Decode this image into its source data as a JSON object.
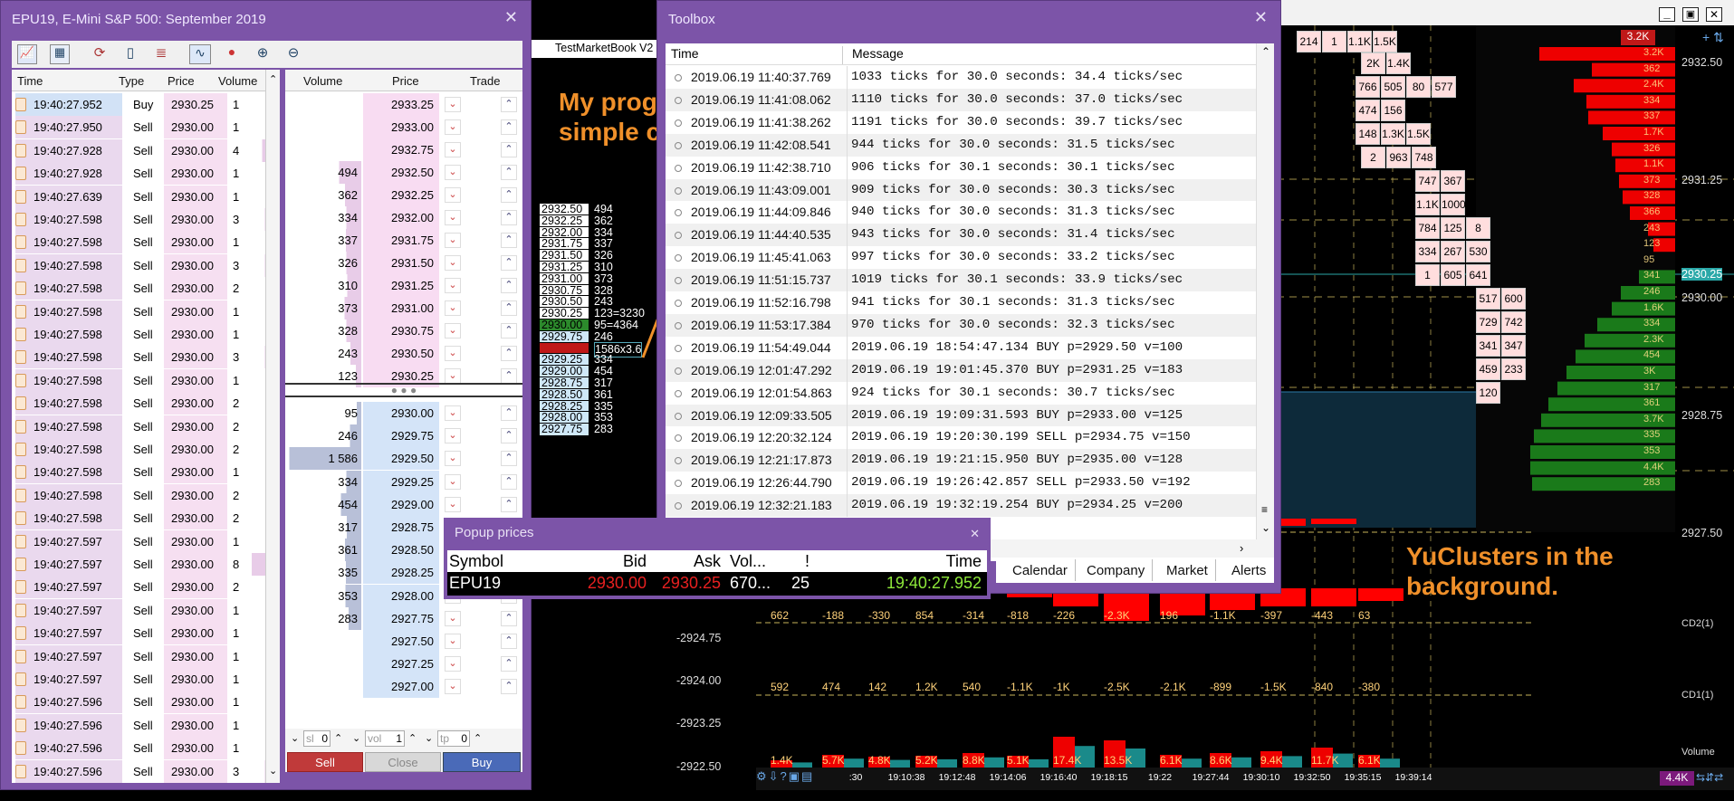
{
  "left_window": {
    "title": "EPU19, E-Mini S&P 500: September 2019",
    "ts_headers": [
      "Time",
      "Type",
      "Price",
      "Volume"
    ],
    "ts_rows": [
      [
        "19:40:27.952",
        "Buy",
        "2930.25",
        "1"
      ],
      [
        "19:40:27.950",
        "Sell",
        "2930.00",
        "1"
      ],
      [
        "19:40:27.928",
        "Sell",
        "2930.00",
        "4"
      ],
      [
        "19:40:27.928",
        "Sell",
        "2930.00",
        "1"
      ],
      [
        "19:40:27.639",
        "Sell",
        "2930.00",
        "1"
      ],
      [
        "19:40:27.598",
        "Sell",
        "2930.00",
        "3"
      ],
      [
        "19:40:27.598",
        "Sell",
        "2930.00",
        "1"
      ],
      [
        "19:40:27.598",
        "Sell",
        "2930.00",
        "3"
      ],
      [
        "19:40:27.598",
        "Sell",
        "2930.00",
        "2"
      ],
      [
        "19:40:27.598",
        "Sell",
        "2930.00",
        "1"
      ],
      [
        "19:40:27.598",
        "Sell",
        "2930.00",
        "1"
      ],
      [
        "19:40:27.598",
        "Sell",
        "2930.00",
        "3"
      ],
      [
        "19:40:27.598",
        "Sell",
        "2930.00",
        "1"
      ],
      [
        "19:40:27.598",
        "Sell",
        "2930.00",
        "2"
      ],
      [
        "19:40:27.598",
        "Sell",
        "2930.00",
        "2"
      ],
      [
        "19:40:27.598",
        "Sell",
        "2930.00",
        "2"
      ],
      [
        "19:40:27.598",
        "Sell",
        "2930.00",
        "1"
      ],
      [
        "19:40:27.598",
        "Sell",
        "2930.00",
        "2"
      ],
      [
        "19:40:27.598",
        "Sell",
        "2930.00",
        "2"
      ],
      [
        "19:40:27.597",
        "Sell",
        "2930.00",
        "1"
      ],
      [
        "19:40:27.597",
        "Sell",
        "2930.00",
        "8"
      ],
      [
        "19:40:27.597",
        "Sell",
        "2930.00",
        "2"
      ],
      [
        "19:40:27.597",
        "Sell",
        "2930.00",
        "1"
      ],
      [
        "19:40:27.597",
        "Sell",
        "2930.00",
        "1"
      ],
      [
        "19:40:27.597",
        "Sell",
        "2930.00",
        "1"
      ],
      [
        "19:40:27.597",
        "Sell",
        "2930.00",
        "1"
      ],
      [
        "19:40:27.596",
        "Sell",
        "2930.00",
        "1"
      ],
      [
        "19:40:27.596",
        "Sell",
        "2930.00",
        "1"
      ],
      [
        "19:40:27.596",
        "Sell",
        "2930.00",
        "1"
      ],
      [
        "19:40:27.596",
        "Sell",
        "2930.00",
        "3"
      ]
    ],
    "dom_headers": [
      "Volume",
      "Price",
      "Trade"
    ],
    "dom_asks": [
      [
        "",
        "2933.25"
      ],
      [
        "",
        "2933.00"
      ],
      [
        "",
        "2932.75"
      ],
      [
        "494",
        "2932.50"
      ],
      [
        "362",
        "2932.25"
      ],
      [
        "334",
        "2932.00"
      ],
      [
        "337",
        "2931.75"
      ],
      [
        "326",
        "2931.50"
      ],
      [
        "310",
        "2931.25"
      ],
      [
        "373",
        "2931.00"
      ],
      [
        "328",
        "2930.75"
      ],
      [
        "243",
        "2930.50"
      ],
      [
        "123",
        "2930.25"
      ]
    ],
    "dom_dots": "● ● ●",
    "dom_bids": [
      [
        "95",
        "2930.00"
      ],
      [
        "246",
        "2929.75"
      ],
      [
        "1 586",
        "2929.50"
      ],
      [
        "334",
        "2929.25"
      ],
      [
        "454",
        "2929.00"
      ],
      [
        "317",
        "2928.75"
      ],
      [
        "361",
        "2928.50"
      ],
      [
        "335",
        "2928.25"
      ],
      [
        "353",
        "2928.00"
      ],
      [
        "283",
        "2927.75"
      ],
      [
        "",
        "2927.50"
      ],
      [
        "",
        "2927.25"
      ],
      [
        "",
        "2927.00"
      ]
    ],
    "bottom": {
      "sl_label": "sl",
      "sl_val": "0",
      "vol_label": "vol",
      "vol_val": "1",
      "tp_label": "tp",
      "tp_val": "0",
      "sell": "Sell",
      "close": "Close",
      "buy": "Buy"
    }
  },
  "market_book": {
    "title": "TestMarketBook V2",
    "rows": [
      [
        "2932.50",
        "494"
      ],
      [
        "2932.25",
        "362"
      ],
      [
        "2932.00",
        "334"
      ],
      [
        "2931.75",
        "337"
      ],
      [
        "2931.50",
        "326"
      ],
      [
        "2931.25",
        "310"
      ],
      [
        "2931.00",
        "373"
      ],
      [
        "2930.75",
        "328"
      ],
      [
        "2930.50",
        "243"
      ],
      [
        "2930.25",
        "123=3230"
      ],
      [
        "2930.00",
        "95=4364"
      ],
      [
        "2929.75",
        "246"
      ],
      [
        "2929.50",
        "1586x3.6"
      ],
      [
        "2929.25",
        "334"
      ],
      [
        "2929.00",
        "454"
      ],
      [
        "2928.75",
        "317"
      ],
      [
        "2928.50",
        "361"
      ],
      [
        "2928.25",
        "335"
      ],
      [
        "2928.00",
        "353"
      ],
      [
        "2927.75",
        "283"
      ]
    ]
  },
  "toolbox": {
    "title": "Toolbox",
    "col_time": "Time",
    "col_message": "Message",
    "rows": [
      [
        "2019.06.19 11:40:37.769",
        "1033 ticks for 30.0 seconds: 34.4 ticks/sec"
      ],
      [
        "2019.06.19 11:41:08.062",
        "1110 ticks for 30.0 seconds: 37.0 ticks/sec"
      ],
      [
        "2019.06.19 11:41:38.262",
        "1191 ticks for 30.0 seconds: 39.7 ticks/sec"
      ],
      [
        "2019.06.19 11:42:08.541",
        "944 ticks for 30.0 seconds: 31.5 ticks/sec"
      ],
      [
        "2019.06.19 11:42:38.710",
        "906 ticks for 30.1 seconds: 30.1 ticks/sec"
      ],
      [
        "2019.06.19 11:43:09.001",
        "909 ticks for 30.0 seconds: 30.3 ticks/sec"
      ],
      [
        "2019.06.19 11:44:09.846",
        "940 ticks for 30.0 seconds: 31.3 ticks/sec"
      ],
      [
        "2019.06.19 11:44:40.535",
        "943 ticks for 30.0 seconds: 31.4 ticks/sec"
      ],
      [
        "2019.06.19 11:45:41.063",
        "997 ticks for 30.0 seconds: 33.2 ticks/sec"
      ],
      [
        "2019.06.19 11:51:15.737",
        "1019 ticks for 30.1 seconds: 33.9 ticks/sec"
      ],
      [
        "2019.06.19 11:52:16.798",
        "941 ticks for 30.1 seconds: 31.3 ticks/sec"
      ],
      [
        "2019.06.19 11:53:17.384",
        "970 ticks for 30.0 seconds: 32.3 ticks/sec"
      ],
      [
        "2019.06.19 11:54:49.044",
        "2019.06.19 18:54:47.134 BUY  p=2929.50 v=100"
      ],
      [
        "2019.06.19 12:01:47.292",
        "2019.06.19 19:01:45.370 BUY  p=2931.25 v=183"
      ],
      [
        "2019.06.19 12:01:54.863",
        "924 ticks for 30.1 seconds: 30.7 ticks/sec"
      ],
      [
        "2019.06.19 12:09:33.505",
        "2019.06.19 19:09:31.593 BUY  p=2933.00 v=125"
      ],
      [
        "2019.06.19 12:20:32.124",
        "2019.06.19 19:20:30.199 SELL p=2934.75 v=150"
      ],
      [
        "2019.06.19 12:21:17.873",
        "2019.06.19 19:21:15.950 BUY  p=2935.00 v=128"
      ],
      [
        "2019.06.19 12:26:44.790",
        "2019.06.19 19:26:42.857 SELL p=2933.50 v=192"
      ],
      [
        "2019.06.19 12:32:21.183",
        "2019.06.19 19:32:19.254 BUY  p=2934.25 v=200"
      ]
    ],
    "tabs": [
      "Calendar",
      "Company",
      "Market",
      "Alerts"
    ]
  },
  "popup": {
    "title": "Popup prices",
    "headers": [
      "Symbol",
      "Bid",
      "Ask",
      "Vol...",
      "!",
      "Time"
    ],
    "row": [
      "EPU19",
      "2930.00",
      "2930.25",
      "670...",
      "25",
      "19:40:27.952"
    ]
  },
  "annotations": {
    "program": "My program making simple calculations",
    "clusters": "YuClusters in the background."
  },
  "right_axis": [
    "2932.50",
    "2931.25",
    "2930.25",
    "2930.00",
    "2928.75",
    "2927.50"
  ],
  "right_axis_top": "3.2K",
  "profile_labels": [
    "3.2K",
    "362",
    "2.4K",
    "334",
    "337",
    "1.7K",
    "326",
    "1.1K",
    "373",
    "328",
    "366",
    "243",
    "123",
    "95",
    "341",
    "246",
    "1.6K",
    "334",
    "2.3K",
    "454",
    "3K",
    "317",
    "361",
    "3.7K",
    "335",
    "353",
    "4.4K",
    "283"
  ],
  "cluster_cells": [
    [
      "214",
      "1",
      "1.1K",
      "1.5K"
    ],
    [
      "2K",
      "1.4K"
    ],
    [
      "766",
      "505",
      "80",
      "577"
    ],
    [
      "474",
      "156"
    ],
    [
      "148",
      "1.3K",
      "1.5K"
    ],
    [
      "2",
      "963",
      "748"
    ],
    [
      "747",
      "367"
    ],
    [
      "1.1K",
      "1000"
    ],
    [
      "784",
      "125",
      "8"
    ],
    [
      "334",
      "267",
      "530"
    ],
    [
      "1",
      "605",
      "641"
    ],
    [
      "517",
      "600"
    ],
    [
      "729",
      "742"
    ],
    [
      "341",
      "347"
    ],
    [
      "459",
      "233"
    ],
    [
      "120"
    ]
  ],
  "lower_axis": [
    "-2924.75",
    "-2924.00",
    "-2923.25",
    "-2922.50"
  ],
  "cd2_values": [
    "662",
    "-188",
    "-330",
    "854",
    "-314",
    "-818",
    "-226",
    "-2.3K",
    "196",
    "-1.1K",
    "-397",
    "-443",
    "63"
  ],
  "cd1_values": [
    "592",
    "474",
    "142",
    "1.2K",
    "540",
    "-1.1K",
    "-1K",
    "-2.5K",
    "-2.1K",
    "-899",
    "-1.5K",
    "-840",
    "-380"
  ],
  "vol_values": [
    "1.4K",
    "5.7K",
    "4.8K",
    "5.2K",
    "8.8K",
    "5.1K",
    "17.4K",
    "13.5K",
    "6.1K",
    "8.6K",
    "9.4K",
    "11.7K",
    "6.1K"
  ],
  "times": [
    ":30",
    "19:10:38",
    "19:12:48",
    "19:14:06",
    "19:16:40",
    "19:18:15",
    "19:22",
    "19:27:44",
    "19:30:10",
    "19:32:50",
    "19:35:15",
    "19:39:14"
  ],
  "indicator_labels": [
    "CD2(1)",
    "CD1(1)",
    "Volume"
  ],
  "bottom_right": "4.4K"
}
